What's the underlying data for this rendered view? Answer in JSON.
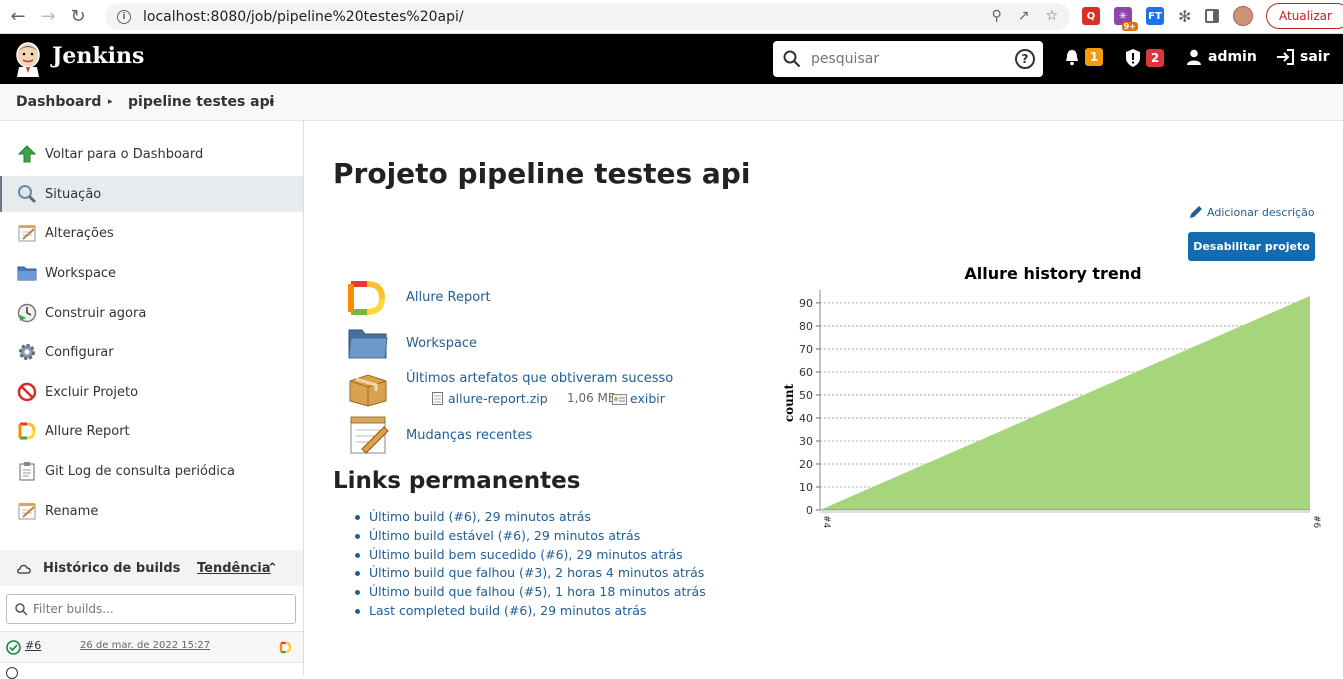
{
  "browser": {
    "url": "localhost:8080/job/pipeline%20testes%20api/",
    "update_label": "Atualizar",
    "ext_badge": "9+",
    "ext_ft": "FT"
  },
  "header": {
    "title": "Jenkins",
    "search_placeholder": "pesquisar",
    "help_glyph": "?",
    "notifications_count": "1",
    "security_count": "2",
    "user": "admin",
    "logout": "sair",
    "colors": {
      "notifications": "#f39c12",
      "security": "#d9363e"
    }
  },
  "breadcrumb": {
    "items": [
      "Dashboard",
      "pipeline testes api"
    ]
  },
  "sidebar": {
    "items": [
      {
        "label": "Voltar para o Dashboard",
        "icon": "up-arrow-icon"
      },
      {
        "label": "Situação",
        "icon": "magnifier-icon"
      },
      {
        "label": "Alterações",
        "icon": "notepad-icon"
      },
      {
        "label": "Workspace",
        "icon": "folder-icon"
      },
      {
        "label": "Construir agora",
        "icon": "clock-play-icon"
      },
      {
        "label": "Configurar",
        "icon": "gear-icon"
      },
      {
        "label": "Excluir Projeto",
        "icon": "no-entry-icon"
      },
      {
        "label": "Allure Report",
        "icon": "allure-icon"
      },
      {
        "label": "Git Log de consulta periódica",
        "icon": "clipboard-icon"
      },
      {
        "label": "Rename",
        "icon": "notepad-icon"
      }
    ],
    "history": {
      "title": "Histórico de builds",
      "trend": "Tendência",
      "filter_placeholder": "Filter builds...",
      "builds": [
        {
          "number": "#6",
          "date": "26 de mar. de 2022 15:27"
        }
      ]
    }
  },
  "main": {
    "title": "Projeto pipeline testes api",
    "add_description": "Adicionar descrição",
    "disable_button": "Desabilitar projeto",
    "links": {
      "allure": "Allure Report",
      "workspace": "Workspace",
      "artifacts": "Últimos artefatos que obtiveram sucesso",
      "artifact_file": "allure-report.zip",
      "artifact_size": "1,06 MB",
      "artifact_view": "exibir",
      "changes": "Mudanças recentes"
    },
    "permalinks_title": "Links permanentes",
    "permalinks": [
      "Último build (#6), 29 minutos atrás",
      "Último build estável (#6), 29 minutos atrás",
      "Último build bem sucedido (#6), 29 minutos atrás",
      "Último build que falhou (#3), 2 horas 4 minutos atrás",
      "Último build que falhou (#5), 1 hora 18 minutos atrás",
      "Last completed build (#6), 29 minutos atrás"
    ]
  },
  "chart_data": {
    "type": "area",
    "title": "Allure history trend",
    "xlabel": "",
    "ylabel": "count",
    "categories": [
      "#4",
      "#6"
    ],
    "series": [
      {
        "values": [
          0,
          93
        ],
        "color": "#a6d57b"
      }
    ],
    "ylim": [
      0,
      93
    ],
    "yticks": [
      0,
      10,
      20,
      30,
      40,
      50,
      60,
      70,
      80,
      90
    ],
    "grid": true
  }
}
